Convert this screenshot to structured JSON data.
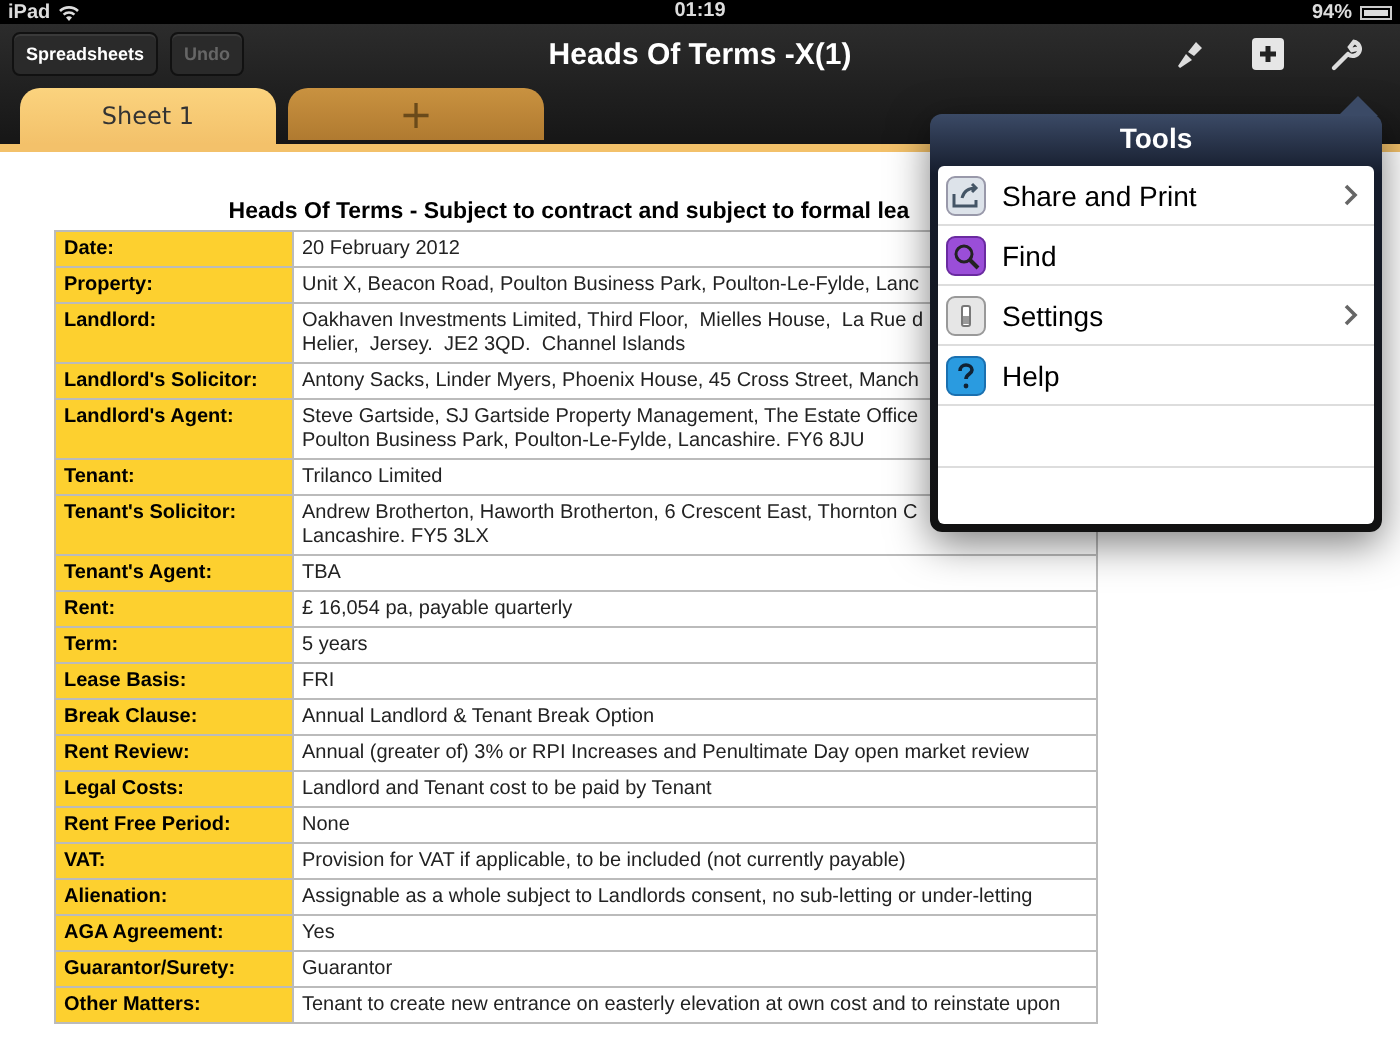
{
  "status_bar": {
    "device": "iPad",
    "time": "01:19",
    "battery": "94%"
  },
  "toolbar": {
    "buttons": [
      {
        "label": "Spreadsheets",
        "disabled": false
      },
      {
        "label": "Undo",
        "disabled": true
      }
    ],
    "title": "Heads Of Terms -X(1)"
  },
  "tabs": [
    {
      "label": "Sheet 1",
      "selected": true
    },
    {
      "label": "+",
      "selected": false
    }
  ],
  "document": {
    "heading": "Heads Of Terms - Subject to contract and subject to formal lea",
    "rows": [
      {
        "label": "Date:",
        "value": "20 February 2012"
      },
      {
        "label": "Property:",
        "value": "Unit X, Beacon Road, Poulton Business Park, Poulton-Le-Fylde, Lanc"
      },
      {
        "label": "Landlord:",
        "value": "Oakhaven Investments Limited, Third Floor,  Mielles House,  La Rue d\nHelier,  Jersey.  JE2 3QD.  Channel Islands"
      },
      {
        "label": "Landlord's Solicitor:",
        "value": "Antony Sacks, Linder Myers, Phoenix House, 45 Cross Street, Manch"
      },
      {
        "label": "Landlord's Agent:",
        "value": "Steve Gartside, SJ Gartside Property Management, The Estate Office\nPoulton Business Park, Poulton-Le-Fylde, Lancashire. FY6 8JU"
      },
      {
        "label": "Tenant:",
        "value": "Trilanco Limited"
      },
      {
        "label": "Tenant's Solicitor:",
        "value": "Andrew Brotherton, Haworth Brotherton, 6 Crescent East, Thornton C\nLancashire. FY5 3LX"
      },
      {
        "label": "Tenant's Agent:",
        "value": "TBA"
      },
      {
        "label": "Rent:",
        "value": "£ 16,054 pa, payable quarterly"
      },
      {
        "label": "Term:",
        "value": "5 years"
      },
      {
        "label": "Lease Basis:",
        "value": "FRI"
      },
      {
        "label": "Break Clause:",
        "value": "Annual Landlord & Tenant Break Option"
      },
      {
        "label": "Rent Review:",
        "value": "Annual (greater of) 3% or RPI Increases and Penultimate Day open market review"
      },
      {
        "label": "Legal Costs:",
        "value": "Landlord and Tenant cost to be paid by Tenant"
      },
      {
        "label": "Rent Free Period:",
        "value": "None"
      },
      {
        "label": "VAT:",
        "value": "Provision for VAT if applicable, to be included (not currently payable)"
      },
      {
        "label": "Alienation:",
        "value": "Assignable as a whole subject to Landlords consent, no sub-letting or under-letting"
      },
      {
        "label": "AGA Agreement:",
        "value": "Yes"
      },
      {
        "label": "Guarantor/Surety:",
        "value": "Guarantor"
      },
      {
        "label": "Other Matters:",
        "value": "Tenant to create new entrance on easterly elevation at own cost and to reinstate upon"
      }
    ]
  },
  "tools_popover": {
    "title": "Tools",
    "items": [
      {
        "label": "Share and Print",
        "kind": "share",
        "has_submenu": true
      },
      {
        "label": "Find",
        "kind": "find",
        "has_submenu": false
      },
      {
        "label": "Settings",
        "kind": "settings",
        "has_submenu": true
      },
      {
        "label": "Help",
        "kind": "help",
        "has_submenu": false
      }
    ]
  }
}
